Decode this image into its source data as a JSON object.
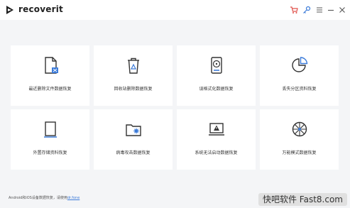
{
  "app": {
    "name": "recoverit"
  },
  "toolbar": {
    "icons": [
      "cart-icon",
      "key-icon",
      "menu-icon",
      "minimize-icon",
      "close-icon"
    ]
  },
  "cards": [
    {
      "label": "最近删除文件数据恢复",
      "icon": "recent-file-icon"
    },
    {
      "label": "回收站删除数据恢复",
      "icon": "recycle-bin-icon"
    },
    {
      "label": "误格式化数据恢复",
      "icon": "hard-drive-icon"
    },
    {
      "label": "丢失分区资料恢复",
      "icon": "partition-icon"
    },
    {
      "label": "外置存储资料恢复",
      "icon": "external-storage-icon"
    },
    {
      "label": "病毒攻击数据恢复",
      "icon": "virus-folder-icon"
    },
    {
      "label": "系统无法启动数据恢复",
      "icon": "system-crash-icon"
    },
    {
      "label": "万能模式数据恢复",
      "icon": "all-around-icon"
    }
  ],
  "footer": {
    "text": "Android和iOS设备数据恢复，请使用",
    "link": "dr.fone"
  },
  "watermark": {
    "text1": "快吧软件",
    "text2": "Fast8.com"
  },
  "colors": {
    "accent": "#3c7bd9",
    "cart": "#e0504a",
    "icon_dark": "#333333"
  }
}
